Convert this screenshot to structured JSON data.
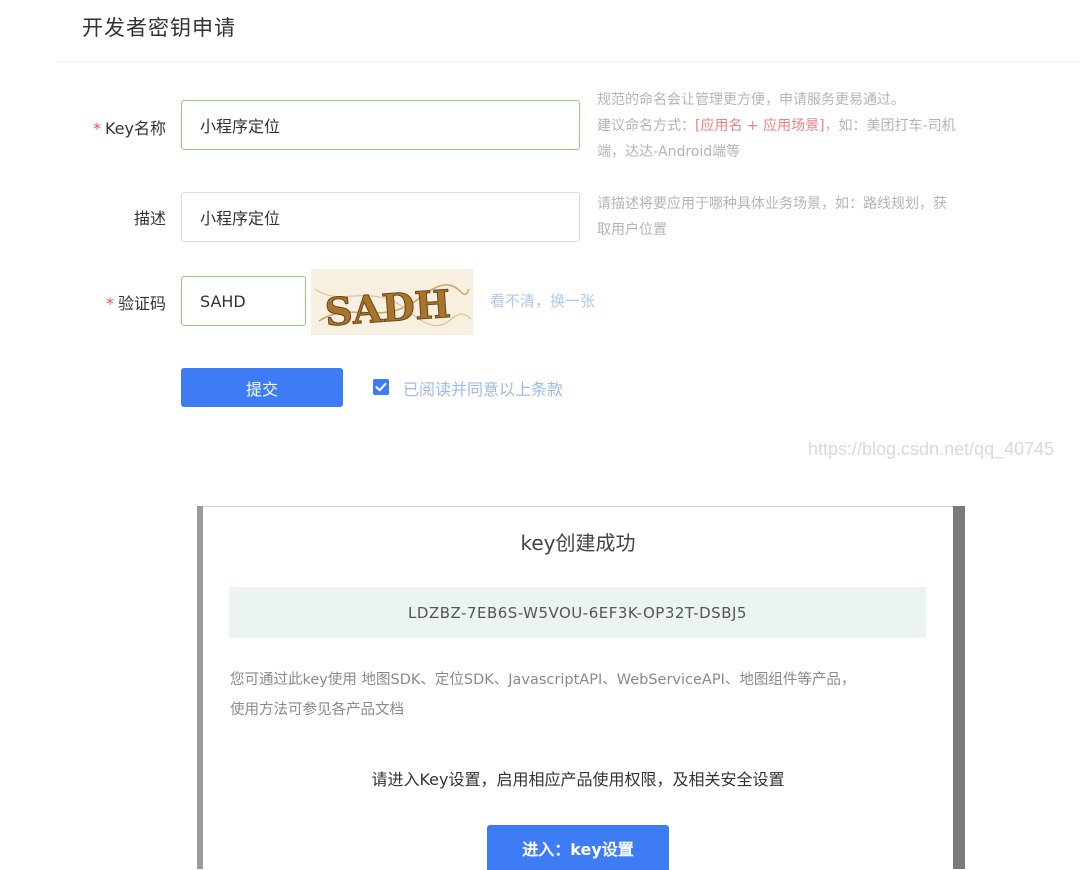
{
  "page": {
    "title": "开发者密钥申请"
  },
  "form": {
    "key_name": {
      "label": "Key名称",
      "value": "小程序定位",
      "hint_line1": "规范的命名会让管理更方便，申请服务更易通过。",
      "hint_line2_prefix": "建议命名方式：",
      "hint_line2_em": "[应用名 + 应用场景]",
      "hint_line2_suffix": "，如：美团打车-司机",
      "hint_line3": "端，达达-Android端等"
    },
    "description": {
      "label": "描述",
      "value": "小程序定位",
      "hint_line1": "请描述将要应用于哪种具体业务场景，如：路线规划，获",
      "hint_line2": "取用户位置"
    },
    "captcha": {
      "label": "验证码",
      "value": "SAHD",
      "image_text": "SADH",
      "refresh_label": "看不清，换一张"
    },
    "required_mark": "*",
    "submit_label": "提交",
    "agree_label": "已阅读并同意以上条款",
    "agree_checked": true
  },
  "watermark": "https://blog.csdn.net/qq_40745",
  "modal": {
    "title": "key创建成功",
    "key_value": "LDZBZ-7EB6S-W5VOU-6EF3K-OP32T-DSBJ5",
    "desc_line1": "您可通过此key使用 地图SDK、定位SDK、JavascriptAPI、WebServiceAPI、地图组件等产品，",
    "desc_line2": "使用方法可参见各产品文档",
    "instruction": "请进入Key设置，启用相应产品使用权限，及相关安全设置",
    "button_label": "进入：key设置"
  },
  "colors": {
    "primary": "#3d7cf5",
    "valid_border": "#8cd07a",
    "required": "#f05050",
    "hint_em": "#f08080",
    "key_box_bg": "#ecf4f3"
  }
}
